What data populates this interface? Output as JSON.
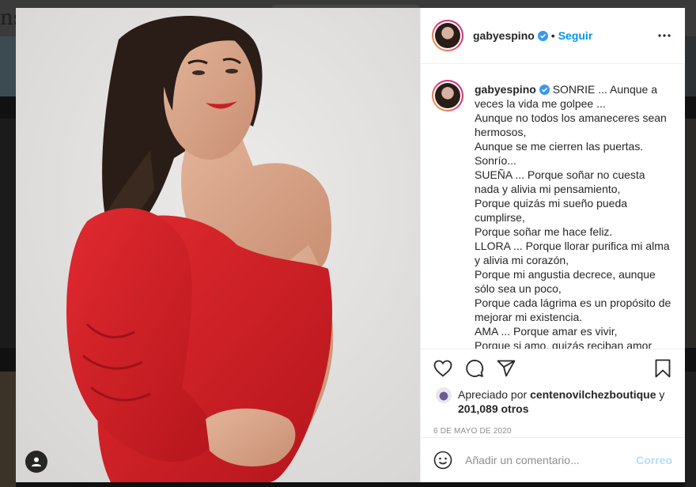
{
  "background": {
    "logo_fragment": "nst"
  },
  "post": {
    "username": "gabyespino",
    "follow_label": "Seguir",
    "separator": "•",
    "caption": "SONRIE ... Aunque a veces la vida me golpee ...\nAunque no todos los amaneceres sean hermosos,\nAunque se me cierren las puertas.\nSonrío...\nSUEÑA ... Porque soñar no cuesta nada y alivia mi pensamiento,\nPorque quizás mi sueño pueda cumplirse,\nPorque soñar me hace feliz.\nLLORA ... Porque llorar purifica mi alma y alivia mi corazón,\nPorque mi angustia decrece, aunque sólo sea un poco,\nPorque cada lágrima es un propósito de mejorar mi existencia.\nAMA ... Porque amar es vivir,\nPorque si amo, quizás reciban amor",
    "likes_prefix": "Apreciado por",
    "liked_by": "centenovilchezboutique",
    "likes_and": "y",
    "likes_count": "201,089 otros",
    "date": "6 DE MAYO DE 2020",
    "comment_placeholder": "Añadir un comentario...",
    "post_label": "Correo"
  },
  "icons": {
    "more": "more-options-icon",
    "like": "heart-icon",
    "comment": "comment-icon",
    "share": "share-icon",
    "save": "bookmark-icon",
    "emoji": "emoji-icon",
    "tag": "user-tag-icon",
    "verified": "verified-badge-icon"
  },
  "colors": {
    "accent": "#0095f6",
    "dress": "#d4242a",
    "muted": "#8e8e8e"
  }
}
